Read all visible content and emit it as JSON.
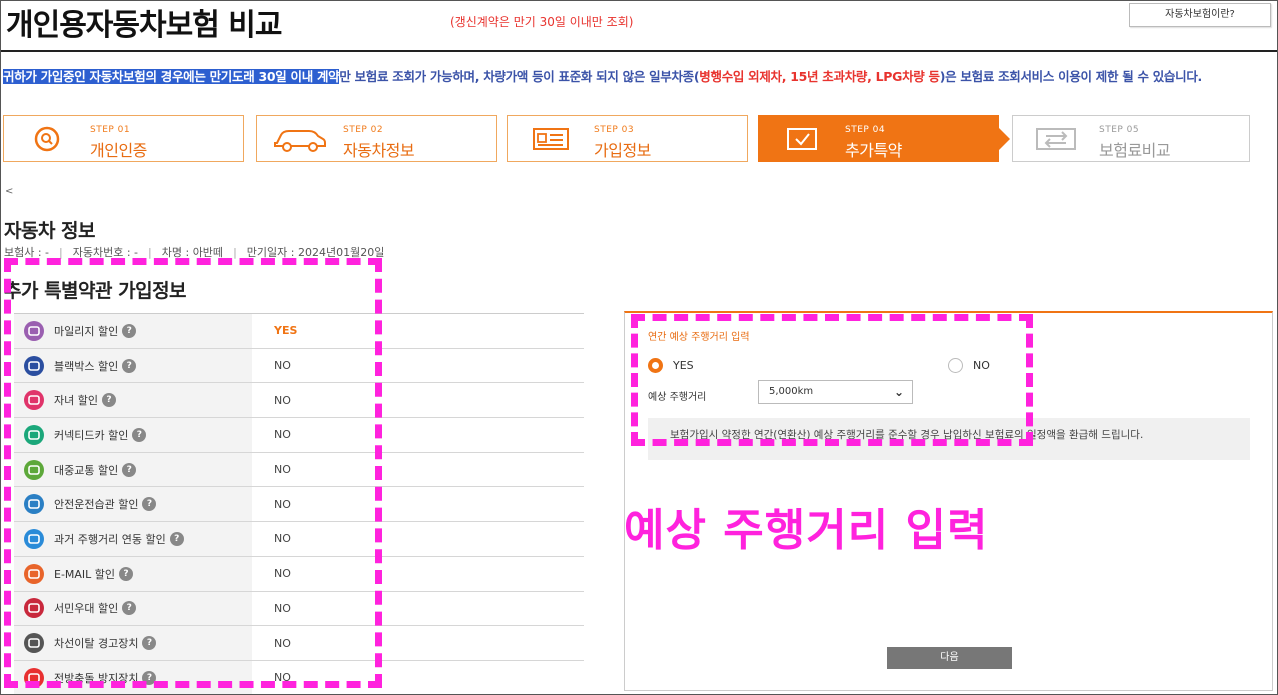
{
  "header": {
    "title": "개인용자동차보험 비교",
    "subtitle": "(갱신계약은 만기 30일 이내만 조회)",
    "help_button": "자동차보험이란?"
  },
  "notice": {
    "highlighted": "귀하가 가입중인 자동차보험의 경우에는 만기도래 30일 이내 계약",
    "part1": "만 보험료 조회가 가능하며, 차량가액 등이 표준화 되지 않은 일부차종(",
    "red": "병행수입 외제차, 15년 초과차량, LPG차량 등",
    "part2": ")은 보험료 조회서비스 이용이 제한 될 수 있습니다."
  },
  "steps": [
    {
      "num": "STEP 01",
      "label": "개인인증",
      "icon": "person-search-icon",
      "state": "done"
    },
    {
      "num": "STEP 02",
      "label": "자동차정보",
      "icon": "car-icon",
      "state": "done"
    },
    {
      "num": "STEP 03",
      "label": "가입정보",
      "icon": "id-card-icon",
      "state": "done"
    },
    {
      "num": "STEP 04",
      "label": "추가특약",
      "icon": "checkbox-icon",
      "state": "active"
    },
    {
      "num": "STEP 05",
      "label": "보험료비교",
      "icon": "compare-arrows-icon",
      "state": "disabled"
    }
  ],
  "back_mark": "<",
  "car_info": {
    "title": "자동차 정보",
    "insurer": "보험사 : -",
    "car_number": "자동차번호 : -",
    "car_model": "차명 : 아반떼",
    "expiry": "만기일자 : 2024년01월20일"
  },
  "terms": {
    "title": "추가 특별약관 가입정보",
    "help_glyph": "?",
    "rows": [
      {
        "name": "마일리지 할인",
        "value": "YES",
        "icon": "mileage-icon",
        "color": "#9a5fb0"
      },
      {
        "name": "블랙박스 할인",
        "value": "NO",
        "icon": "blackbox-icon",
        "color": "#2b4ea0"
      },
      {
        "name": "자녀 할인",
        "value": "NO",
        "icon": "child-icon",
        "color": "#e0346a"
      },
      {
        "name": "커넥티드카 할인",
        "value": "NO",
        "icon": "connected-car-icon",
        "color": "#1ba77a"
      },
      {
        "name": "대중교통 할인",
        "value": "NO",
        "icon": "bus-icon",
        "color": "#5da83a"
      },
      {
        "name": "안전운전습관 할인",
        "value": "NO",
        "icon": "safe-driving-icon",
        "color": "#2a7fc4"
      },
      {
        "name": "과거 주행거리 연동 할인",
        "value": "NO",
        "icon": "past-mileage-icon",
        "color": "#2a8bd8"
      },
      {
        "name": "E-MAIL 할인",
        "value": "NO",
        "icon": "email-icon",
        "color": "#e8642a"
      },
      {
        "name": "서민우대 할인",
        "value": "NO",
        "icon": "family-icon",
        "color": "#c8283c"
      },
      {
        "name": "차선이탈 경고장치",
        "value": "NO",
        "icon": "lane-departure-icon",
        "color": "#555555"
      },
      {
        "name": "전방충돌 방지장치",
        "value": "NO",
        "icon": "collision-icon",
        "color": "#e83030"
      }
    ]
  },
  "mileage_panel": {
    "title": "연간 예상 주행거리 입력",
    "yes_label": "YES",
    "no_label": "NO",
    "selected": "YES",
    "distance_label": "예상 주행거리",
    "distance_value": "5,000km",
    "note": "보험가입시 약정한 연간(연환산) 예상 주행거리를 준수할 경우 납입하신 보험료의 일정액을 환급해 드립니다.",
    "next_button": "다음"
  },
  "annotation": {
    "caption": "예상 주행거리 입력",
    "color": "#ff22dd"
  },
  "colors": {
    "accent": "#f07414",
    "notice_blue": "#3b53a8",
    "notice_red": "#e8332e"
  }
}
